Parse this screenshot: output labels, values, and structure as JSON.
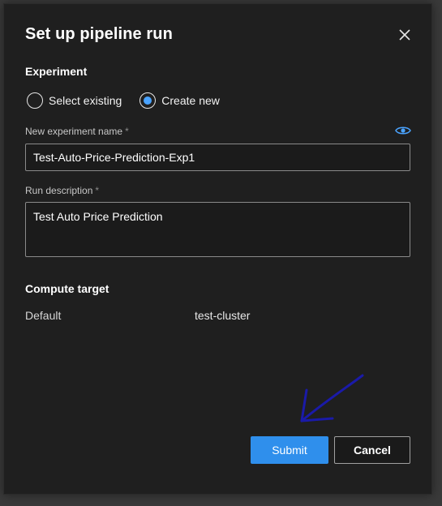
{
  "dialog": {
    "title": "Set up pipeline run",
    "close_icon": "close-icon"
  },
  "experiment": {
    "heading": "Experiment",
    "options": [
      {
        "label": "Select existing",
        "selected": false
      },
      {
        "label": "Create new",
        "selected": true
      }
    ],
    "accent_color": "#4aa3ff"
  },
  "new_experiment_name": {
    "label": "New experiment name",
    "required_marker": "*",
    "value": "Test-Auto-Price-Prediction-Exp1",
    "visibility_icon": "eye-icon"
  },
  "run_description": {
    "label": "Run description",
    "required_marker": "*",
    "value": "Test Auto Price Prediction"
  },
  "compute_target": {
    "heading": "Compute target",
    "key": "Default",
    "value": "test-cluster"
  },
  "actions": {
    "submit_label": "Submit",
    "cancel_label": "Cancel",
    "primary_color": "#2f8fec"
  },
  "annotation": {
    "arrow_color": "#1a1aa8"
  }
}
